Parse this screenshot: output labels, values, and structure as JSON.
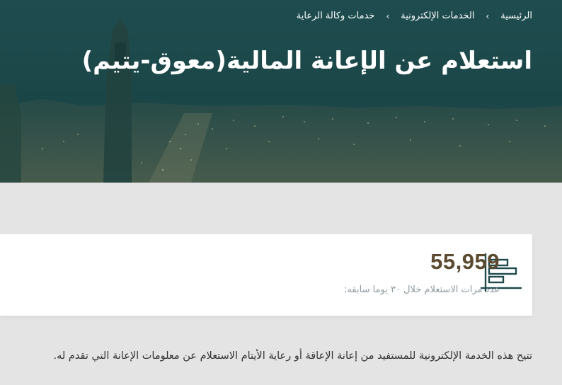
{
  "breadcrumb": {
    "items": [
      {
        "label": "الرئيسية"
      },
      {
        "label": "الخدمات الإلكترونية"
      },
      {
        "label": "خدمات وكالة الرعاية"
      }
    ],
    "separator": "›"
  },
  "page": {
    "title": "استعلام عن الإعانة المالية(معوق-يتيم)"
  },
  "stats": {
    "value": "55,959",
    "label": "عدد مرات الاستعلام خلال ٣٠ يوما سابقه:",
    "icon": "bar-chart-icon"
  },
  "description": "تتيح هذه الخدمة الإلكترونية للمستفيد من إعانة الإعاقة أو رعاية الأيتام الاستعلام عن معلومات الإعانة التي تقدم له.",
  "colors": {
    "hero": "#1d4a4c",
    "accent": "#5b4a2f",
    "icon": "#1f4a4c",
    "muted": "#8e9aa2",
    "page_bg": "#e4e4e4"
  }
}
